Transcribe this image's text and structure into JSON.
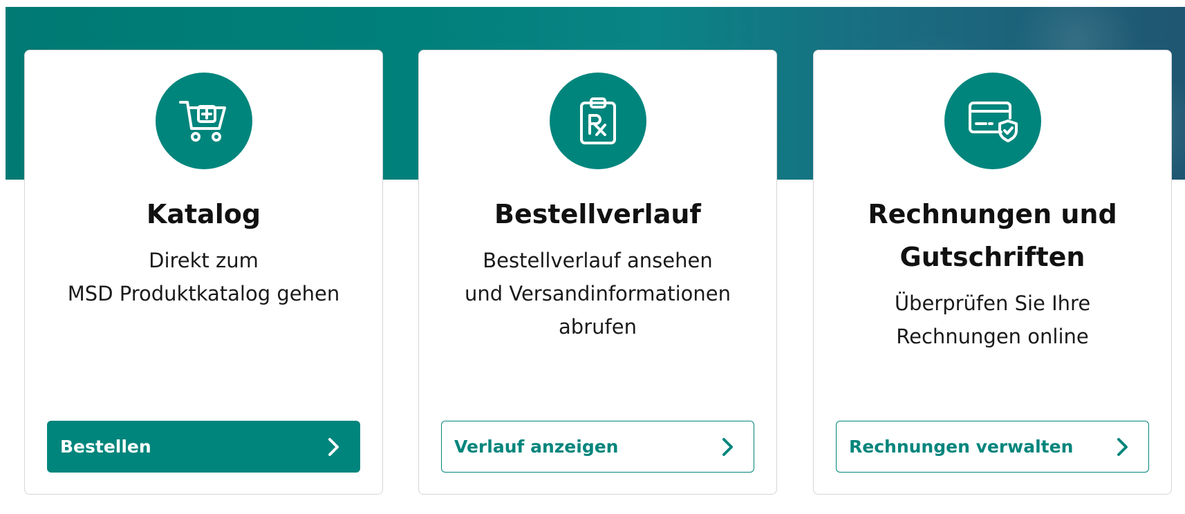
{
  "colors": {
    "brand_teal": "#00857c",
    "banner_start": "#007a73",
    "banner_end": "#1f5671",
    "card_border": "#d6d6d6",
    "text_dark": "#111111"
  },
  "cards": [
    {
      "icon": "shopping-cart-plus-icon",
      "title": "Katalog",
      "description_lines": [
        "Direkt zum",
        "MSD Produktkatalog gehen"
      ],
      "button": {
        "label": "Bestellen",
        "style": "primary",
        "icon": "chevron-right-icon"
      }
    },
    {
      "icon": "prescription-clipboard-icon",
      "title": "Bestellverlauf",
      "description_lines": [
        "Bestellverlauf ansehen",
        "und Versandinformationen",
        "abrufen"
      ],
      "button": {
        "label": "Verlauf anzeigen",
        "style": "outline",
        "icon": "chevron-right-icon"
      }
    },
    {
      "icon": "credit-card-shield-icon",
      "title_lines": [
        "Rechnungen und",
        "Gutschriften"
      ],
      "description_lines": [
        "Überprüfen Sie Ihre",
        "Rechnungen online"
      ],
      "button": {
        "label": "Rechnungen verwalten",
        "style": "outline",
        "icon": "chevron-right-icon"
      }
    }
  ]
}
